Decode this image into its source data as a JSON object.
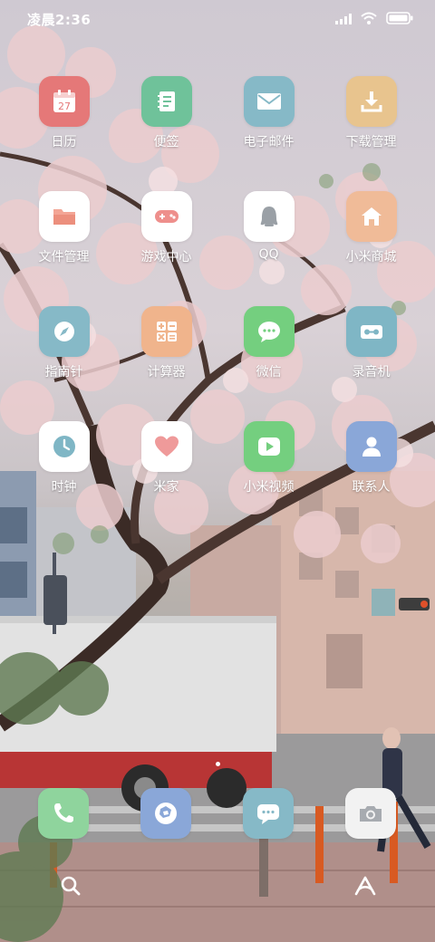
{
  "status_bar": {
    "time": "凌晨2:36"
  },
  "apps": [
    {
      "name": "calendar",
      "label": "日历",
      "icon": "calendar-icon",
      "color": "#e57878",
      "day": "27"
    },
    {
      "name": "notes",
      "label": "便签",
      "icon": "notes-icon",
      "color": "#6fc29a"
    },
    {
      "name": "email",
      "label": "电子邮件",
      "icon": "mail-icon",
      "color": "#86b9c7"
    },
    {
      "name": "downloads",
      "label": "下载管理",
      "icon": "download-icon",
      "color": "#e8c48e"
    },
    {
      "name": "files",
      "label": "文件管理",
      "icon": "folder-icon",
      "color": "#ffffff"
    },
    {
      "name": "game-center",
      "label": "游戏中心",
      "icon": "gamepad-icon",
      "color": "#ffffff"
    },
    {
      "name": "qq",
      "label": "QQ",
      "icon": "qq-icon",
      "color": "#ffffff"
    },
    {
      "name": "mi-store",
      "label": "小米商城",
      "icon": "store-icon",
      "color": "#f0bb98"
    },
    {
      "name": "compass",
      "label": "指南针",
      "icon": "compass-icon",
      "color": "#86b9c7"
    },
    {
      "name": "calculator",
      "label": "计算器",
      "icon": "calculator-icon",
      "color": "#f0b48c"
    },
    {
      "name": "wechat",
      "label": "微信",
      "icon": "wechat-icon",
      "color": "#74cf7f"
    },
    {
      "name": "recorder",
      "label": "录音机",
      "icon": "recorder-icon",
      "color": "#7fb6c5"
    },
    {
      "name": "clock",
      "label": "时钟",
      "icon": "clock-icon",
      "color": "#ffffff"
    },
    {
      "name": "mijia",
      "label": "米家",
      "icon": "heart-icon",
      "color": "#ffffff"
    },
    {
      "name": "mi-video",
      "label": "小米视频",
      "icon": "play-icon",
      "color": "#74cf7f"
    },
    {
      "name": "contacts",
      "label": "联系人",
      "icon": "contact-icon",
      "color": "#8aa7d8"
    }
  ],
  "dock": [
    {
      "name": "phone",
      "icon": "phone-icon",
      "color": "#8fd49d"
    },
    {
      "name": "browser",
      "icon": "browser-icon",
      "color": "#8aa7d8"
    },
    {
      "name": "messages",
      "icon": "message-icon",
      "color": "#86b9c7"
    },
    {
      "name": "camera",
      "icon": "camera-icon",
      "color": "#f2f2f2"
    }
  ],
  "page_indicator": {
    "pages": 1,
    "current": 1
  },
  "bottom_bar": {
    "left_icon": "search-icon",
    "right_icon": "assistant-icon"
  }
}
